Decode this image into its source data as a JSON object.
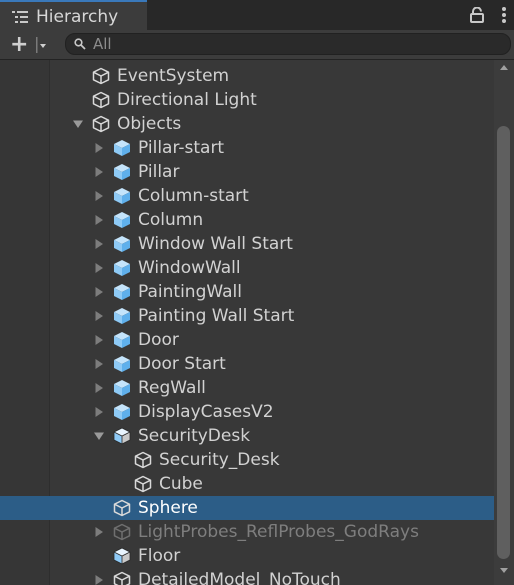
{
  "window": {
    "tab_title": "Hierarchy",
    "tab_icon": "hierarchy-list-icon"
  },
  "tab_actions": [
    "lock-icon",
    "more-vertical-icon"
  ],
  "toolbar": {
    "add_label": "+",
    "add_icon": "add-dropdown-icon",
    "search_placeholder": "All",
    "search_value": ""
  },
  "colors": {
    "accent": "#3a79bb",
    "selection": "#2c5d87",
    "prefab_blue": "#8ecaf6",
    "text": "#d2d2d2",
    "text_dim": "#7e7e7e",
    "background": "#383838"
  },
  "tree": [
    {
      "label": "EventSystem",
      "icon": "gameobject-icon",
      "depth": 1,
      "expander": "none",
      "state": "normal"
    },
    {
      "label": "Directional Light",
      "icon": "gameobject-icon",
      "depth": 1,
      "expander": "none",
      "state": "normal"
    },
    {
      "label": "Objects",
      "icon": "gameobject-icon",
      "depth": 1,
      "expander": "expanded",
      "state": "normal"
    },
    {
      "label": "Pillar-start",
      "icon": "prefab-icon",
      "depth": 2,
      "expander": "collapsed",
      "state": "normal"
    },
    {
      "label": "Pillar",
      "icon": "prefab-icon",
      "depth": 2,
      "expander": "collapsed",
      "state": "normal"
    },
    {
      "label": "Column-start",
      "icon": "prefab-icon",
      "depth": 2,
      "expander": "collapsed",
      "state": "normal"
    },
    {
      "label": "Column",
      "icon": "prefab-icon",
      "depth": 2,
      "expander": "collapsed",
      "state": "normal"
    },
    {
      "label": "Window Wall Start",
      "icon": "prefab-icon",
      "depth": 2,
      "expander": "collapsed",
      "state": "normal"
    },
    {
      "label": "WindowWall",
      "icon": "prefab-icon",
      "depth": 2,
      "expander": "collapsed",
      "state": "normal"
    },
    {
      "label": "PaintingWall",
      "icon": "prefab-icon",
      "depth": 2,
      "expander": "collapsed",
      "state": "normal"
    },
    {
      "label": "Painting Wall Start",
      "icon": "prefab-icon",
      "depth": 2,
      "expander": "collapsed",
      "state": "normal"
    },
    {
      "label": "Door",
      "icon": "prefab-icon",
      "depth": 2,
      "expander": "collapsed",
      "state": "normal"
    },
    {
      "label": "Door Start",
      "icon": "prefab-icon",
      "depth": 2,
      "expander": "collapsed",
      "state": "normal"
    },
    {
      "label": "RegWall",
      "icon": "prefab-icon",
      "depth": 2,
      "expander": "collapsed",
      "state": "normal"
    },
    {
      "label": "DisplayCasesV2",
      "icon": "prefab-icon",
      "depth": 2,
      "expander": "collapsed",
      "state": "normal"
    },
    {
      "label": "SecurityDesk",
      "icon": "prefab-model-icon",
      "depth": 2,
      "expander": "expanded",
      "state": "normal"
    },
    {
      "label": "Security_Desk",
      "icon": "gameobject-icon",
      "depth": 3,
      "expander": "none",
      "state": "normal"
    },
    {
      "label": "Cube",
      "icon": "gameobject-icon",
      "depth": 3,
      "expander": "none",
      "state": "normal"
    },
    {
      "label": "Sphere",
      "icon": "gameobject-icon",
      "depth": 2,
      "expander": "none",
      "state": "selected"
    },
    {
      "label": "LightProbes_ReflProbes_GodRays",
      "icon": "gameobject-icon",
      "depth": 2,
      "expander": "collapsed",
      "state": "dim"
    },
    {
      "label": "Floor",
      "icon": "prefab-model-icon",
      "depth": 2,
      "expander": "none",
      "state": "normal"
    },
    {
      "label": "DetailedModel_NoTouch",
      "icon": "gameobject-icon",
      "depth": 2,
      "expander": "collapsed",
      "state": "normal"
    }
  ],
  "scrollbar": {
    "position": 0.12
  }
}
